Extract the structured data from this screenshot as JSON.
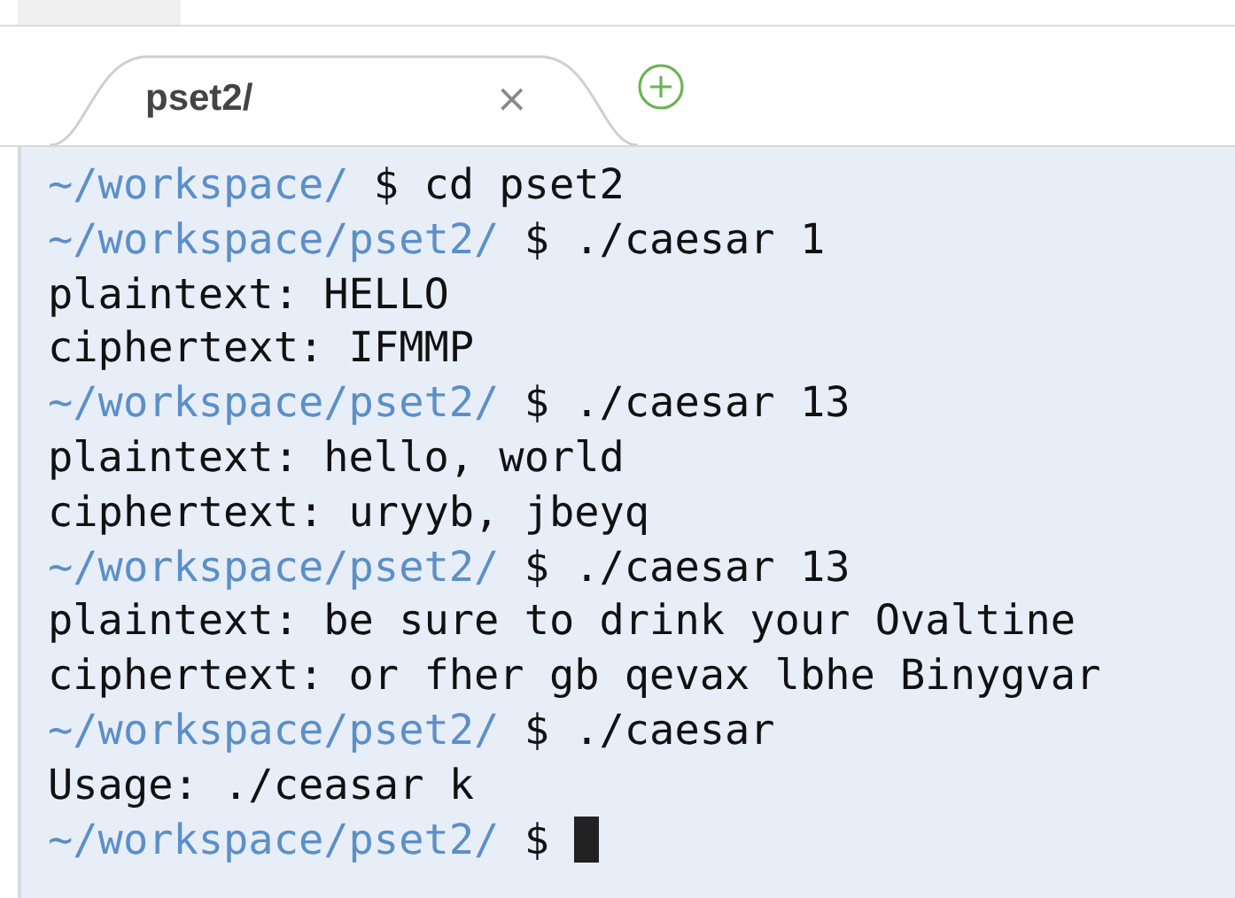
{
  "tabs": [
    {
      "label": "pset2/",
      "close": "×",
      "selected": true
    }
  ],
  "terminal": {
    "lines": [
      {
        "kind": "prompt",
        "path": "~/workspace/",
        "command": "$ cd pset2",
        "cursor": false
      },
      {
        "kind": "prompt",
        "path": "~/workspace/pset2/",
        "command": "$ ./caesar 1",
        "cursor": false
      },
      {
        "kind": "output",
        "text": "plaintext: HELLO"
      },
      {
        "kind": "output",
        "text": "ciphertext: IFMMP"
      },
      {
        "kind": "prompt",
        "path": "~/workspace/pset2/",
        "command": "$ ./caesar 13",
        "cursor": false
      },
      {
        "kind": "output",
        "text": "plaintext: hello, world"
      },
      {
        "kind": "output",
        "text": "ciphertext: uryyb, jbeyq"
      },
      {
        "kind": "prompt",
        "path": "~/workspace/pset2/",
        "command": "$ ./caesar 13",
        "cursor": false
      },
      {
        "kind": "output",
        "text": "plaintext: be sure to drink your Ovaltine"
      },
      {
        "kind": "output",
        "text": "ciphertext: or fher gb qevax lbhe Binygvar"
      },
      {
        "kind": "prompt",
        "path": "~/workspace/pset2/",
        "command": "$ ./caesar",
        "cursor": false
      },
      {
        "kind": "output",
        "text": "Usage: ./ceasar k"
      },
      {
        "kind": "prompt",
        "path": "~/workspace/pset2/",
        "command": "$",
        "cursor": true
      }
    ]
  }
}
